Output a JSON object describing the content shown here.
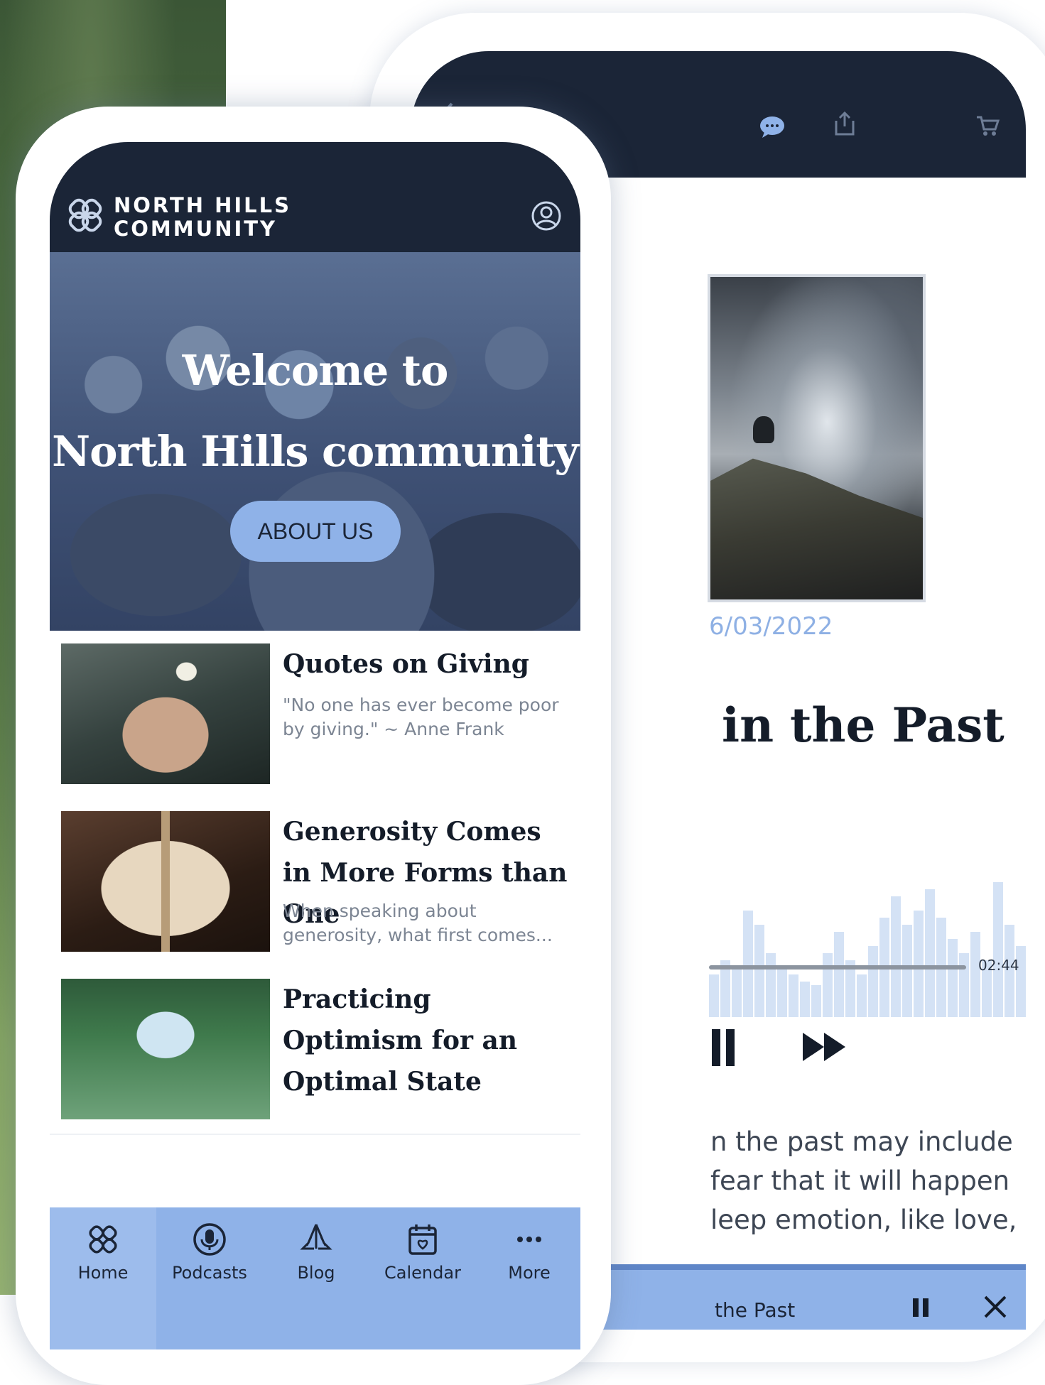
{
  "front": {
    "brand": {
      "line1": "NORTH HILLS",
      "line2": "COMMUNITY"
    },
    "hero": {
      "title_line1": "Welcome to",
      "title_line2": "North Hills community",
      "button_label": "ABOUT US"
    },
    "feed": [
      {
        "title": "Quotes on Giving",
        "excerpt": "\"No one has ever become poor by giving.\" ~ Anne Frank"
      },
      {
        "title": "Generosity Comes in More Forms than One",
        "excerpt": "When speaking about generosity, what first comes..."
      },
      {
        "title": "Practicing Optimism for an Optimal State",
        "excerpt": ""
      }
    ],
    "tabs": [
      {
        "label": "Home",
        "icon": "home-knot-icon"
      },
      {
        "label": "Podcasts",
        "icon": "microphone-icon"
      },
      {
        "label": "Blog",
        "icon": "praying-hands-icon"
      },
      {
        "label": "Calendar",
        "icon": "calendar-icon"
      },
      {
        "label": "More",
        "icon": "more-dots-icon"
      }
    ]
  },
  "back": {
    "date": "6/03/2022",
    "title": "in the Past",
    "duration": "02:44",
    "body_lines": [
      "n the past may include",
      "fear that it will happen",
      "leep emotion, like love,"
    ],
    "miniplayer_title": "the Past",
    "toolbar_icons": [
      "back-arrow-icon",
      "chat-icon",
      "share-icon",
      "cart-icon"
    ]
  },
  "colors": {
    "navy": "#1b2537",
    "accent_blue": "#8fb2e8",
    "date_blue": "#8eb0e4"
  }
}
